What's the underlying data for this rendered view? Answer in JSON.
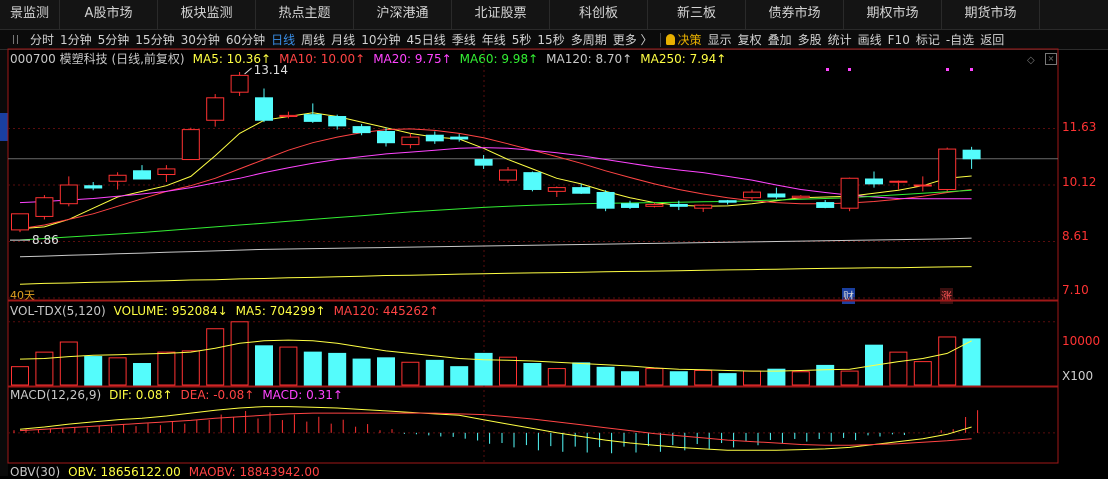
{
  "topnav": [
    "景监测",
    "A股市场",
    "板块监测",
    "热点主题",
    "沪深港通",
    "北证股票",
    "科创板",
    "新三板",
    "债券市场",
    "期权市场",
    "期货市场"
  ],
  "toolbar": {
    "periods": [
      "分时",
      "1分钟",
      "5分钟",
      "15分钟",
      "30分钟",
      "60分钟",
      "日线",
      "周线",
      "月线",
      "10分钟",
      "45日线",
      "季线",
      "年线",
      "5秒",
      "15秒",
      "多周期",
      "更多 〉"
    ],
    "active": "日线",
    "decision": "决策",
    "tools": [
      "显示",
      "复权",
      "叠加",
      "多股",
      "统计",
      "画线",
      "F10",
      "标记",
      "-自选",
      "返回"
    ]
  },
  "price_panel": {
    "title": "000700 模塑科技 (日线,前复权)",
    "ma5": "MA5: 10.36↑",
    "ma10": "MA10: 10.00↑",
    "ma20": "MA20: 9.75↑",
    "ma60": "MA60: 9.98↑",
    "ma120": "MA120: 8.70↑",
    "ma250": "MA250: 7.94↑",
    "axis_labels": [
      "11.63",
      "10.12",
      "8.61",
      "7.10"
    ],
    "high_mark": "13.14",
    "low_mark": "8.86",
    "days_label": "40天",
    "marker_cai": "财",
    "marker_zhang": "涨"
  },
  "volume_panel": {
    "title": "VOL-TDX(5,120)",
    "volume": "VOLUME: 952084↓",
    "ma5": "MA5: 704299↑",
    "ma120": "MA120: 445262↑",
    "axis_label": "10000",
    "unit": "X100"
  },
  "macd_panel": {
    "title": "MACD(12,26,9)",
    "dif": "DIF: 0.08↑",
    "dea": "DEA: -0.08↑",
    "macd": "MACD: 0.31↑"
  },
  "obv_panel": {
    "title": "OBV(30)",
    "obv": "OBV: 18656122.00",
    "maobv": "MAOBV: 18843942.00"
  },
  "chart_data": {
    "type": "candlestick",
    "ylim": [
      7.1,
      13.3
    ],
    "candles": [
      {
        "o": 8.92,
        "h": 9.12,
        "l": 8.86,
        "c": 9.35
      },
      {
        "o": 9.28,
        "h": 9.85,
        "l": 9.2,
        "c": 9.78
      },
      {
        "o": 9.62,
        "h": 10.35,
        "l": 9.55,
        "c": 10.12
      },
      {
        "o": 10.1,
        "h": 10.2,
        "l": 9.98,
        "c": 10.04
      },
      {
        "o": 10.22,
        "h": 10.46,
        "l": 10.0,
        "c": 10.38
      },
      {
        "o": 10.5,
        "h": 10.65,
        "l": 10.28,
        "c": 10.28
      },
      {
        "o": 10.4,
        "h": 10.65,
        "l": 10.2,
        "c": 10.55
      },
      {
        "o": 10.8,
        "h": 11.65,
        "l": 10.8,
        "c": 11.6
      },
      {
        "o": 11.85,
        "h": 12.55,
        "l": 11.68,
        "c": 12.45
      },
      {
        "o": 12.6,
        "h": 13.14,
        "l": 12.5,
        "c": 13.05
      },
      {
        "o": 12.45,
        "h": 12.7,
        "l": 11.8,
        "c": 11.85
      },
      {
        "o": 11.95,
        "h": 12.08,
        "l": 11.9,
        "c": 11.98
      },
      {
        "o": 12.0,
        "h": 12.3,
        "l": 11.78,
        "c": 11.82
      },
      {
        "o": 11.95,
        "h": 12.0,
        "l": 11.6,
        "c": 11.7
      },
      {
        "o": 11.68,
        "h": 11.75,
        "l": 11.45,
        "c": 11.52
      },
      {
        "o": 11.55,
        "h": 11.65,
        "l": 11.15,
        "c": 11.25
      },
      {
        "o": 11.2,
        "h": 11.5,
        "l": 11.1,
        "c": 11.4
      },
      {
        "o": 11.45,
        "h": 11.55,
        "l": 11.22,
        "c": 11.3
      },
      {
        "o": 11.4,
        "h": 11.48,
        "l": 11.28,
        "c": 11.35
      },
      {
        "o": 10.8,
        "h": 10.92,
        "l": 10.55,
        "c": 10.65
      },
      {
        "o": 10.25,
        "h": 10.6,
        "l": 10.18,
        "c": 10.52
      },
      {
        "o": 10.45,
        "h": 10.48,
        "l": 9.95,
        "c": 10.0
      },
      {
        "o": 9.95,
        "h": 10.08,
        "l": 9.8,
        "c": 10.05
      },
      {
        "o": 10.05,
        "h": 10.15,
        "l": 9.88,
        "c": 9.9
      },
      {
        "o": 9.92,
        "h": 9.98,
        "l": 9.42,
        "c": 9.5
      },
      {
        "o": 9.62,
        "h": 9.7,
        "l": 9.48,
        "c": 9.52
      },
      {
        "o": 9.55,
        "h": 9.65,
        "l": 9.52,
        "c": 9.6
      },
      {
        "o": 9.6,
        "h": 9.7,
        "l": 9.45,
        "c": 9.55
      },
      {
        "o": 9.5,
        "h": 9.6,
        "l": 9.4,
        "c": 9.58
      },
      {
        "o": 9.7,
        "h": 9.72,
        "l": 9.6,
        "c": 9.66
      },
      {
        "o": 9.78,
        "h": 10.0,
        "l": 9.7,
        "c": 9.93
      },
      {
        "o": 9.88,
        "h": 10.05,
        "l": 9.75,
        "c": 9.8
      },
      {
        "o": 9.78,
        "h": 9.85,
        "l": 9.75,
        "c": 9.82
      },
      {
        "o": 9.65,
        "h": 9.72,
        "l": 9.5,
        "c": 9.52
      },
      {
        "o": 9.5,
        "h": 10.32,
        "l": 9.42,
        "c": 10.3
      },
      {
        "o": 10.28,
        "h": 10.48,
        "l": 10.05,
        "c": 10.15
      },
      {
        "o": 10.2,
        "h": 10.24,
        "l": 10.0,
        "c": 10.22
      },
      {
        "o": 10.1,
        "h": 10.35,
        "l": 9.95,
        "c": 10.12
      },
      {
        "o": 10.0,
        "h": 11.12,
        "l": 9.95,
        "c": 11.08
      },
      {
        "o": 11.05,
        "h": 11.14,
        "l": 10.55,
        "c": 10.82
      }
    ],
    "ma_lines": [
      {
        "name": "MA5",
        "color": "#ffff44",
        "values": [
          8.95,
          9.0,
          9.2,
          9.5,
          9.8,
          9.95,
          10.1,
          10.35,
          10.9,
          11.5,
          11.85,
          11.95,
          12.05,
          11.95,
          11.8,
          11.65,
          11.5,
          11.4,
          11.35,
          11.1,
          10.8,
          10.55,
          10.3,
          10.15,
          9.95,
          9.78,
          9.65,
          9.58,
          9.55,
          9.56,
          9.62,
          9.7,
          9.78,
          9.8,
          9.82,
          9.9,
          9.98,
          10.1,
          10.3,
          10.36
        ]
      },
      {
        "name": "MA10",
        "color": "#ff4444",
        "values": [
          8.95,
          9.05,
          9.2,
          9.35,
          9.55,
          9.75,
          9.95,
          10.1,
          10.3,
          10.55,
          10.8,
          11.05,
          11.25,
          11.4,
          11.52,
          11.6,
          11.62,
          11.58,
          11.5,
          11.38,
          11.22,
          11.05,
          10.88,
          10.7,
          10.5,
          10.32,
          10.15,
          10.0,
          9.88,
          9.78,
          9.7,
          9.65,
          9.62,
          9.62,
          9.64,
          9.68,
          9.74,
          9.82,
          9.92,
          10.0
        ]
      },
      {
        "name": "MA20",
        "color": "#ff44ff",
        "values": [
          9.65,
          9.68,
          9.72,
          9.76,
          9.82,
          9.88,
          9.95,
          10.05,
          10.18,
          10.3,
          10.45,
          10.58,
          10.7,
          10.8,
          10.88,
          10.95,
          11.0,
          11.05,
          11.1,
          11.12,
          11.1,
          11.05,
          10.98,
          10.9,
          10.8,
          10.7,
          10.6,
          10.52,
          10.45,
          10.35,
          10.25,
          10.12,
          10.0,
          9.92,
          9.85,
          9.8,
          9.76,
          9.75,
          9.75,
          9.75
        ]
      },
      {
        "name": "MA60",
        "color": "#33ee33",
        "values": [
          8.65,
          8.69,
          8.73,
          8.77,
          8.81,
          8.85,
          8.9,
          8.95,
          9.0,
          9.05,
          9.1,
          9.15,
          9.2,
          9.25,
          9.3,
          9.35,
          9.4,
          9.44,
          9.48,
          9.52,
          9.55,
          9.58,
          9.6,
          9.62,
          9.63,
          9.64,
          9.65,
          9.66,
          9.67,
          9.68,
          9.7,
          9.72,
          9.74,
          9.76,
          9.78,
          9.82,
          9.86,
          9.9,
          9.94,
          9.98
        ]
      },
      {
        "name": "MA120",
        "color": "#c8c8c8",
        "values": [
          8.2,
          8.22,
          8.24,
          8.26,
          8.28,
          8.3,
          8.32,
          8.34,
          8.36,
          8.38,
          8.4,
          8.41,
          8.42,
          8.43,
          8.44,
          8.45,
          8.46,
          8.47,
          8.48,
          8.49,
          8.5,
          8.51,
          8.52,
          8.53,
          8.54,
          8.55,
          8.56,
          8.57,
          8.58,
          8.59,
          8.6,
          8.61,
          8.62,
          8.63,
          8.64,
          8.65,
          8.66,
          8.67,
          8.68,
          8.7
        ]
      },
      {
        "name": "MA250",
        "color": "#ffff44",
        "values": [
          7.47,
          7.49,
          7.5,
          7.52,
          7.53,
          7.55,
          7.56,
          7.58,
          7.59,
          7.61,
          7.62,
          7.64,
          7.65,
          7.67,
          7.68,
          7.7,
          7.71,
          7.72,
          7.74,
          7.75,
          7.76,
          7.77,
          7.78,
          7.79,
          7.8,
          7.81,
          7.82,
          7.83,
          7.84,
          7.85,
          7.86,
          7.87,
          7.88,
          7.89,
          7.9,
          7.91,
          7.91,
          7.92,
          7.93,
          7.94
        ]
      }
    ],
    "volume_ylim": [
      0,
      10600
    ],
    "volumes": [
      2900,
      5200,
      6800,
      4500,
      4300,
      3400,
      5200,
      5400,
      8900,
      10000,
      6200,
      6000,
      5200,
      5000,
      4100,
      4300,
      3600,
      3900,
      2900,
      5000,
      4400,
      3400,
      2600,
      3500,
      2800,
      2100,
      2600,
      2100,
      2300,
      1800,
      2200,
      2500,
      2100,
      3100,
      2200,
      6300,
      5200,
      3700,
      7600,
      7300
    ],
    "volume_ma5": [
      4100,
      4200,
      4500,
      4700,
      4800,
      4900,
      5000,
      5200,
      5800,
      6600,
      7000,
      7100,
      7000,
      6600,
      6000,
      5400,
      5000,
      4600,
      4200,
      4000,
      3900,
      3800,
      3600,
      3400,
      3200,
      3000,
      2700,
      2500,
      2400,
      2300,
      2200,
      2200,
      2300,
      2400,
      2500,
      3100,
      3700,
      4200,
      5000,
      7000
    ],
    "macd_ylim": [
      -0.4,
      0.45
    ],
    "macd_bars": [
      0.05,
      0.06,
      0.08,
      0.1,
      0.12,
      0.13,
      0.15,
      0.18,
      0.25,
      0.3,
      0.28,
      0.25,
      0.22,
      0.18,
      0.12,
      0.05,
      -0.02,
      -0.05,
      -0.08,
      -0.15,
      -0.2,
      -0.24,
      -0.26,
      -0.27,
      -0.28,
      -0.27,
      -0.26,
      -0.24,
      -0.22,
      -0.2,
      -0.17,
      -0.14,
      -0.12,
      -0.12,
      -0.1,
      -0.05,
      -0.03,
      0.0,
      0.05,
      0.31
    ],
    "macd_dif": [
      0.05,
      0.08,
      0.12,
      0.15,
      0.18,
      0.2,
      0.23,
      0.27,
      0.31,
      0.34,
      0.36,
      0.36,
      0.35,
      0.34,
      0.32,
      0.3,
      0.28,
      0.26,
      0.24,
      0.18,
      0.12,
      0.06,
      0.0,
      -0.05,
      -0.1,
      -0.14,
      -0.17,
      -0.2,
      -0.22,
      -0.24,
      -0.24,
      -0.24,
      -0.23,
      -0.22,
      -0.2,
      -0.16,
      -0.12,
      -0.08,
      -0.02,
      0.08
    ],
    "macd_dea": [
      0.03,
      0.05,
      0.07,
      0.09,
      0.11,
      0.13,
      0.15,
      0.17,
      0.2,
      0.22,
      0.24,
      0.26,
      0.27,
      0.27,
      0.27,
      0.27,
      0.27,
      0.27,
      0.26,
      0.25,
      0.22,
      0.19,
      0.15,
      0.11,
      0.07,
      0.03,
      -0.01,
      -0.04,
      -0.07,
      -0.1,
      -0.12,
      -0.14,
      -0.16,
      -0.17,
      -0.17,
      -0.16,
      -0.15,
      -0.13,
      -0.11,
      -0.08
    ]
  }
}
